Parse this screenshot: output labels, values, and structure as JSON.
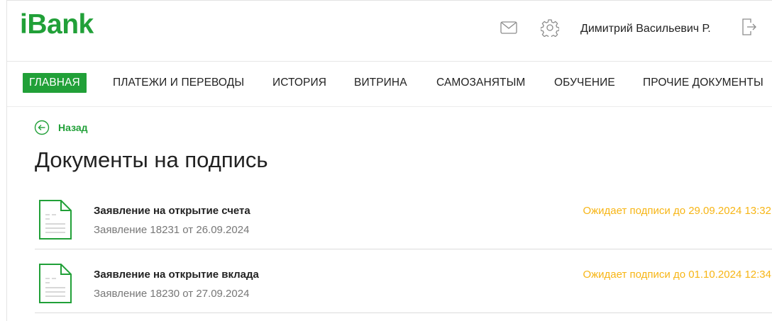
{
  "header": {
    "logo": "iBank",
    "user_name": "Димитрий Васильевич Р.",
    "icons": [
      "mail-icon",
      "gear-icon",
      "logout-icon"
    ]
  },
  "nav": {
    "items": [
      {
        "label": "ГЛАВНАЯ",
        "active": true
      },
      {
        "label": "ПЛАТЕЖИ И ПЕРЕВОДЫ",
        "active": false
      },
      {
        "label": "ИСТОРИЯ",
        "active": false
      },
      {
        "label": "ВИТРИНА",
        "active": false
      },
      {
        "label": "САМОЗАНЯТЫМ",
        "active": false
      },
      {
        "label": "ОБУЧЕНИЕ",
        "active": false
      },
      {
        "label": "ПРОЧИЕ ДОКУМЕНТЫ",
        "active": false
      }
    ]
  },
  "main": {
    "back_label": "Назад",
    "title": "Документы на подпись",
    "documents": [
      {
        "title": "Заявление на открытие счета",
        "subtitle": "Заявление 18231 от 26.09.2024",
        "status": "Ожидает подписи до 29.09.2024 13:32"
      },
      {
        "title": "Заявление на открытие вклада",
        "subtitle": "Заявление 18230 от 27.09.2024",
        "status": "Ожидает подписи до 01.10.2024 12:34"
      }
    ]
  },
  "colors": {
    "brand_green": "#21a038",
    "status_yellow": "#f7b515",
    "text_dark": "#222222",
    "text_muted": "#777777"
  }
}
